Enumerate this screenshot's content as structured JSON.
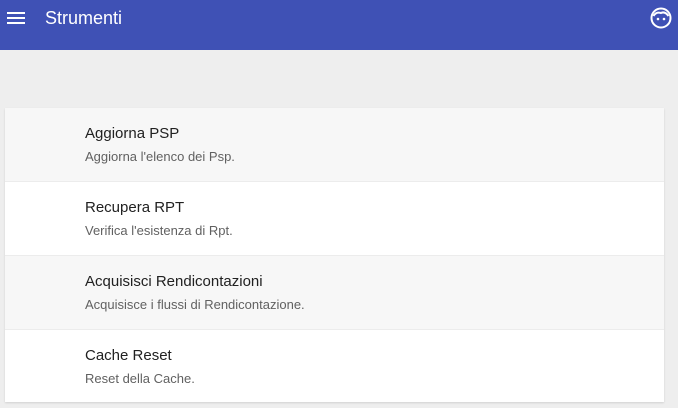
{
  "appbar": {
    "title": "Strumenti",
    "menu_icon": "hamburger-menu-icon",
    "user_icon": "user-avatar-icon",
    "color": "#3f51b5"
  },
  "tools": {
    "items": [
      {
        "title": "Aggiorna PSP",
        "description": "Aggiorna l'elenco dei Psp."
      },
      {
        "title": "Recupera RPT",
        "description": "Verifica l'esistenza di Rpt."
      },
      {
        "title": "Acquisisci Rendicontazioni",
        "description": "Acquisisce i flussi di Rendicontazione."
      },
      {
        "title": "Cache Reset",
        "description": "Reset della Cache."
      }
    ]
  }
}
